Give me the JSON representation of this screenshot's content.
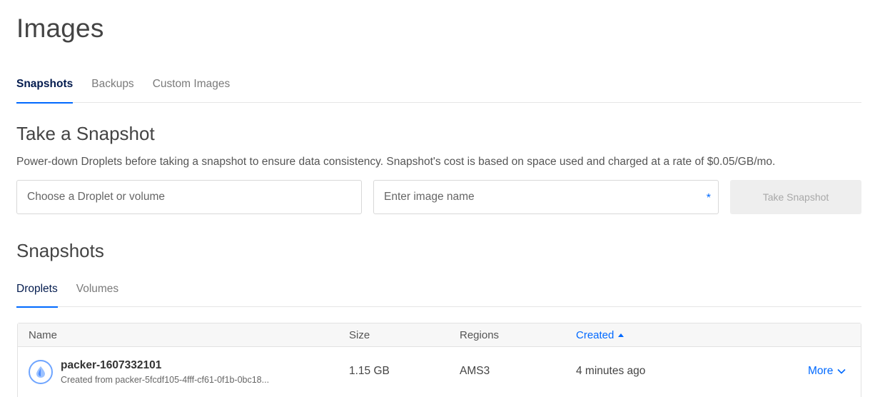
{
  "page": {
    "title": "Images"
  },
  "tabs": [
    {
      "label": "Snapshots",
      "active": true
    },
    {
      "label": "Backups",
      "active": false
    },
    {
      "label": "Custom Images",
      "active": false
    }
  ],
  "take_snapshot": {
    "title": "Take a Snapshot",
    "description": "Power-down Droplets before taking a snapshot to ensure data consistency. Snapshot's cost is based on space used and charged at a rate of $0.05/GB/mo.",
    "droplet_select_placeholder": "Choose a Droplet or volume",
    "image_name_placeholder": "Enter image name",
    "required_marker": "*",
    "button_label": "Take Snapshot"
  },
  "snapshots": {
    "title": "Snapshots",
    "subtabs": [
      {
        "label": "Droplets",
        "active": true
      },
      {
        "label": "Volumes",
        "active": false
      }
    ],
    "columns": {
      "name": "Name",
      "size": "Size",
      "regions": "Regions",
      "created": "Created"
    },
    "sort_column": "created",
    "sort_direction": "ascending",
    "rows": [
      {
        "name": "packer-1607332101",
        "source": "Created from packer-5fcdf105-4fff-cf61-0f1b-0bc18...",
        "size": "1.15 GB",
        "region": "AMS3",
        "created": "4 minutes ago",
        "more_label": "More",
        "icon": "droplet-icon"
      }
    ]
  },
  "colors": {
    "accent": "#0069ff",
    "active_tab_text": "#031b4e",
    "disabled_button_bg": "#eeeeee"
  }
}
